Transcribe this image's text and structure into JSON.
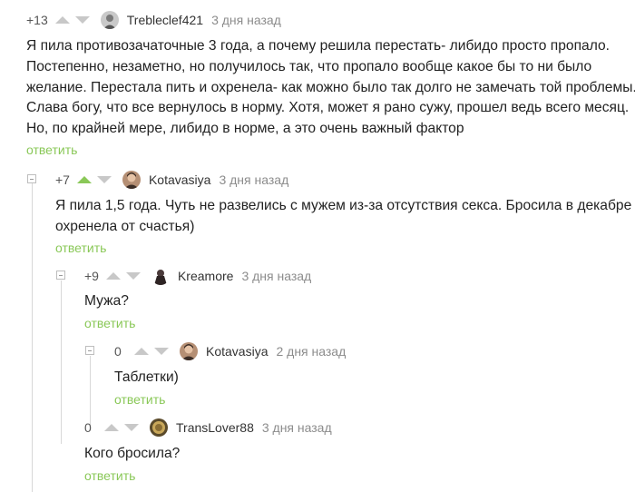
{
  "comments": [
    {
      "rating": "+13",
      "username": "Trebleclef421",
      "time": "3 дня назад",
      "lines": [
        "Я пила противозачаточные 3 года, а почему решила перестать- либидо просто пропало.",
        "Постепенно, незаметно, но получилось так, что пропало вообще какое бы то ни было",
        "желание. Перестала пить и охренела- как можно было так долго не замечать той проблемы.",
        "Слава богу, что все вернулось в норму. Хотя, может я рано сужу, прошел ведь всего месяц.",
        "Но, по крайней мере, либидо в норме, а это очень важный фактор"
      ],
      "reply_label": "ответить"
    },
    {
      "rating": "+7",
      "username": "Kotavasiya",
      "time": "3 дня назад",
      "lines": [
        "Я пила 1,5 года. Чуть не развелись с мужем из-за отсутствия секса. Бросила в декабре и",
        "охренела от счастья)"
      ],
      "reply_label": "ответить"
    },
    {
      "rating": "+9",
      "username": "Kreamore",
      "time": "3 дня назад",
      "lines": [
        "Мужа?"
      ],
      "reply_label": "ответить"
    },
    {
      "rating": "0",
      "username": "Kotavasiya",
      "time": "2 дня назад",
      "lines": [
        "Таблетки)"
      ],
      "reply_label": "ответить"
    },
    {
      "rating": "0",
      "username": "TransLover88",
      "time": "3 дня назад",
      "lines": [
        "Кого бросила?"
      ],
      "reply_label": "ответить"
    }
  ],
  "colors": {
    "accent": "#8ac858",
    "arrow_inactive": "#c8c8c8",
    "muted_text": "#8c8c8c",
    "thread_line": "#d8d8d8"
  }
}
